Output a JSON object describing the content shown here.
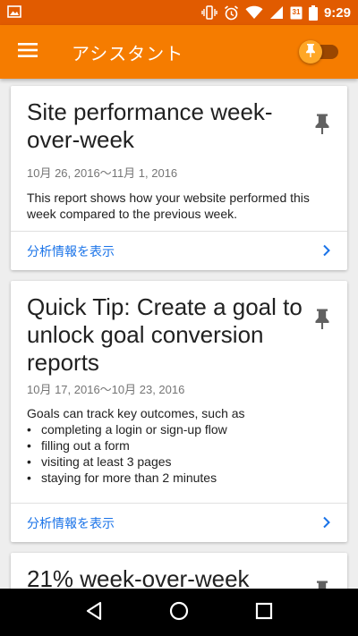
{
  "status_bar": {
    "time": "9:29",
    "date_badge": "31"
  },
  "app_bar": {
    "title": "アシスタント"
  },
  "cards": [
    {
      "title": "Site performance week-over-week",
      "date": "10月 26, 2016〜11月 1, 2016",
      "body": "This report shows how your website performed this week compared to the previous week.",
      "action_label": "分析情報を表示"
    },
    {
      "title": "Quick Tip: Create a goal to unlock goal conversion reports",
      "date": "10月 17, 2016〜10月 23, 2016",
      "body_intro": "Goals can track key outcomes, such as",
      "bullets": [
        "completing a login or sign-up flow",
        "filling out a form",
        "visiting at least 3 pages",
        "staying for more than 2 minutes"
      ],
      "action_label": "分析情報を表示"
    },
    {
      "title": "21% week-over-week"
    }
  ],
  "colors": {
    "status_bar": "#e15b00",
    "app_bar": "#f57c00",
    "link": "#1a73e8"
  }
}
